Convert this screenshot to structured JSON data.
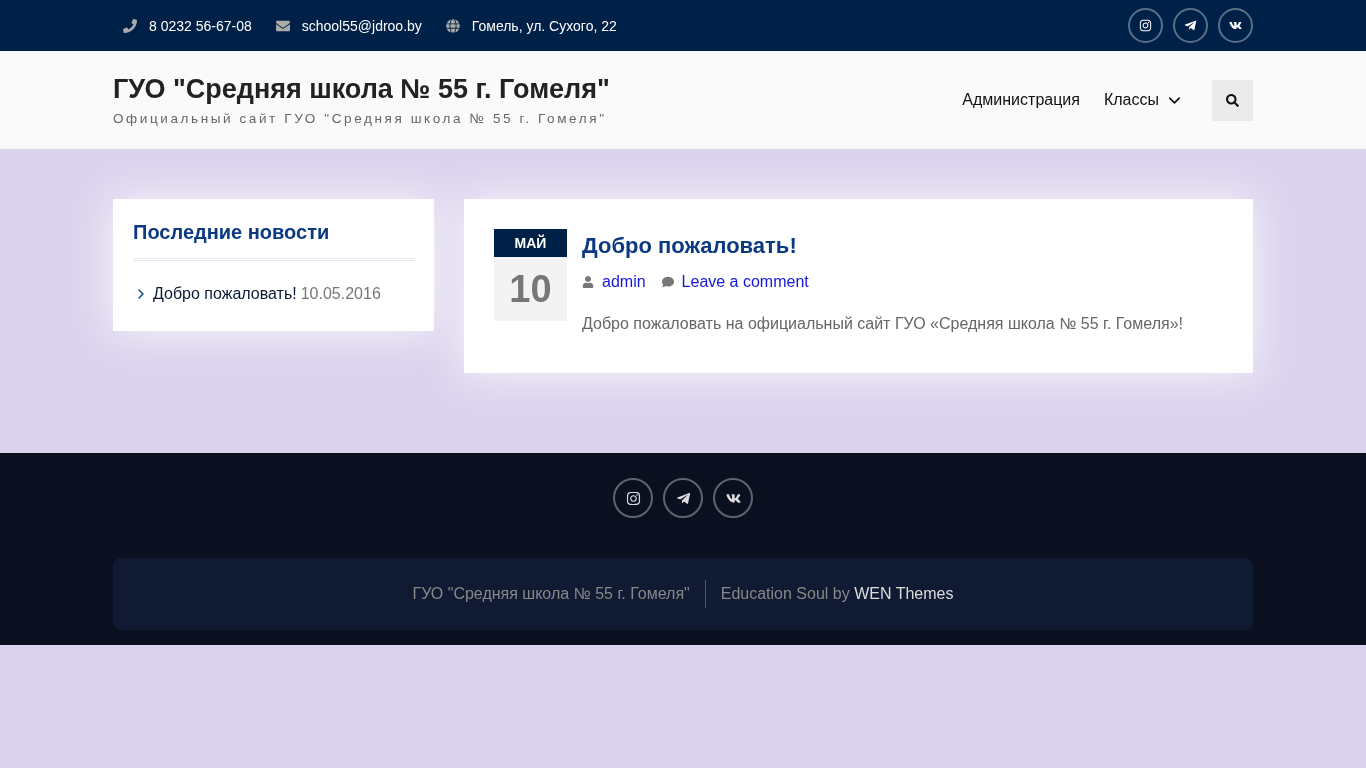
{
  "top_bar": {
    "contacts": [
      {
        "kind": "phone",
        "text": "8 0232 56-67-08"
      },
      {
        "kind": "email",
        "text": "school55@jdroo.by"
      },
      {
        "kind": "globe",
        "text": "Гомель, ул. Сухого, 22"
      }
    ],
    "social": [
      {
        "kind": "instagram"
      },
      {
        "kind": "telegram"
      },
      {
        "kind": "vk"
      }
    ]
  },
  "header": {
    "site_title": "ГУО \"Средняя школа № 55 г. Гомеля\"",
    "tagline": "Официальный сайт ГУО \"Средняя школа № 55 г. Гомеля\"",
    "nav": [
      {
        "label": "Администрация",
        "has_submenu": false
      },
      {
        "label": "Классы",
        "has_submenu": true
      }
    ]
  },
  "sidebar": {
    "title": "Последние новости",
    "items": [
      {
        "title": "Добро пожаловать!",
        "date": "10.05.2016"
      }
    ]
  },
  "post": {
    "month": "МАЙ",
    "day": "10",
    "title": "Добро пожаловать!",
    "author": "admin",
    "comments": "Leave a comment",
    "excerpt": "Добро пожаловать на официальный сайт ГУО «Средняя школа № 55 г. Гомеля»!"
  },
  "footer": {
    "social": [
      {
        "kind": "instagram"
      },
      {
        "kind": "telegram"
      },
      {
        "kind": "vk"
      }
    ],
    "copyright": "ГУО \"Средняя школа № 55 г. Гомеля\"",
    "credit": "Education Soul by ",
    "credit_link": "WEN Themes"
  }
}
